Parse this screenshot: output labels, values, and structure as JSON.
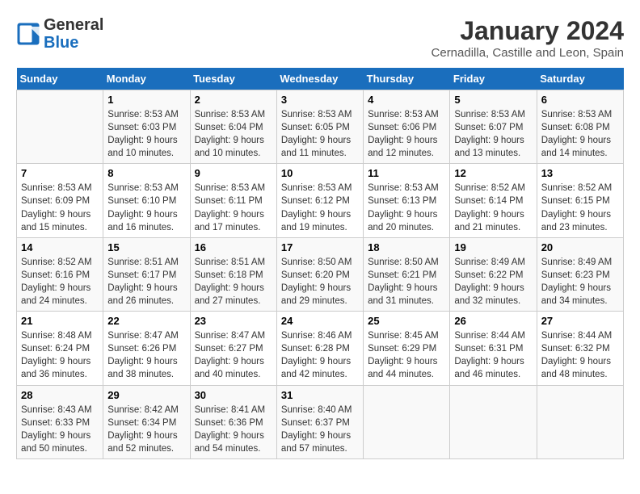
{
  "logo": {
    "line1": "General",
    "line2": "Blue"
  },
  "title": "January 2024",
  "subtitle": "Cernadilla, Castille and Leon, Spain",
  "days_of_week": [
    "Sunday",
    "Monday",
    "Tuesday",
    "Wednesday",
    "Thursday",
    "Friday",
    "Saturday"
  ],
  "weeks": [
    [
      {
        "day": "",
        "text": ""
      },
      {
        "day": "1",
        "text": "Sunrise: 8:53 AM\nSunset: 6:03 PM\nDaylight: 9 hours\nand 10 minutes."
      },
      {
        "day": "2",
        "text": "Sunrise: 8:53 AM\nSunset: 6:04 PM\nDaylight: 9 hours\nand 10 minutes."
      },
      {
        "day": "3",
        "text": "Sunrise: 8:53 AM\nSunset: 6:05 PM\nDaylight: 9 hours\nand 11 minutes."
      },
      {
        "day": "4",
        "text": "Sunrise: 8:53 AM\nSunset: 6:06 PM\nDaylight: 9 hours\nand 12 minutes."
      },
      {
        "day": "5",
        "text": "Sunrise: 8:53 AM\nSunset: 6:07 PM\nDaylight: 9 hours\nand 13 minutes."
      },
      {
        "day": "6",
        "text": "Sunrise: 8:53 AM\nSunset: 6:08 PM\nDaylight: 9 hours\nand 14 minutes."
      }
    ],
    [
      {
        "day": "7",
        "text": "Sunrise: 8:53 AM\nSunset: 6:09 PM\nDaylight: 9 hours\nand 15 minutes."
      },
      {
        "day": "8",
        "text": "Sunrise: 8:53 AM\nSunset: 6:10 PM\nDaylight: 9 hours\nand 16 minutes."
      },
      {
        "day": "9",
        "text": "Sunrise: 8:53 AM\nSunset: 6:11 PM\nDaylight: 9 hours\nand 17 minutes."
      },
      {
        "day": "10",
        "text": "Sunrise: 8:53 AM\nSunset: 6:12 PM\nDaylight: 9 hours\nand 19 minutes."
      },
      {
        "day": "11",
        "text": "Sunrise: 8:53 AM\nSunset: 6:13 PM\nDaylight: 9 hours\nand 20 minutes."
      },
      {
        "day": "12",
        "text": "Sunrise: 8:52 AM\nSunset: 6:14 PM\nDaylight: 9 hours\nand 21 minutes."
      },
      {
        "day": "13",
        "text": "Sunrise: 8:52 AM\nSunset: 6:15 PM\nDaylight: 9 hours\nand 23 minutes."
      }
    ],
    [
      {
        "day": "14",
        "text": "Sunrise: 8:52 AM\nSunset: 6:16 PM\nDaylight: 9 hours\nand 24 minutes."
      },
      {
        "day": "15",
        "text": "Sunrise: 8:51 AM\nSunset: 6:17 PM\nDaylight: 9 hours\nand 26 minutes."
      },
      {
        "day": "16",
        "text": "Sunrise: 8:51 AM\nSunset: 6:18 PM\nDaylight: 9 hours\nand 27 minutes."
      },
      {
        "day": "17",
        "text": "Sunrise: 8:50 AM\nSunset: 6:20 PM\nDaylight: 9 hours\nand 29 minutes."
      },
      {
        "day": "18",
        "text": "Sunrise: 8:50 AM\nSunset: 6:21 PM\nDaylight: 9 hours\nand 31 minutes."
      },
      {
        "day": "19",
        "text": "Sunrise: 8:49 AM\nSunset: 6:22 PM\nDaylight: 9 hours\nand 32 minutes."
      },
      {
        "day": "20",
        "text": "Sunrise: 8:49 AM\nSunset: 6:23 PM\nDaylight: 9 hours\nand 34 minutes."
      }
    ],
    [
      {
        "day": "21",
        "text": "Sunrise: 8:48 AM\nSunset: 6:24 PM\nDaylight: 9 hours\nand 36 minutes."
      },
      {
        "day": "22",
        "text": "Sunrise: 8:47 AM\nSunset: 6:26 PM\nDaylight: 9 hours\nand 38 minutes."
      },
      {
        "day": "23",
        "text": "Sunrise: 8:47 AM\nSunset: 6:27 PM\nDaylight: 9 hours\nand 40 minutes."
      },
      {
        "day": "24",
        "text": "Sunrise: 8:46 AM\nSunset: 6:28 PM\nDaylight: 9 hours\nand 42 minutes."
      },
      {
        "day": "25",
        "text": "Sunrise: 8:45 AM\nSunset: 6:29 PM\nDaylight: 9 hours\nand 44 minutes."
      },
      {
        "day": "26",
        "text": "Sunrise: 8:44 AM\nSunset: 6:31 PM\nDaylight: 9 hours\nand 46 minutes."
      },
      {
        "day": "27",
        "text": "Sunrise: 8:44 AM\nSunset: 6:32 PM\nDaylight: 9 hours\nand 48 minutes."
      }
    ],
    [
      {
        "day": "28",
        "text": "Sunrise: 8:43 AM\nSunset: 6:33 PM\nDaylight: 9 hours\nand 50 minutes."
      },
      {
        "day": "29",
        "text": "Sunrise: 8:42 AM\nSunset: 6:34 PM\nDaylight: 9 hours\nand 52 minutes."
      },
      {
        "day": "30",
        "text": "Sunrise: 8:41 AM\nSunset: 6:36 PM\nDaylight: 9 hours\nand 54 minutes."
      },
      {
        "day": "31",
        "text": "Sunrise: 8:40 AM\nSunset: 6:37 PM\nDaylight: 9 hours\nand 57 minutes."
      },
      {
        "day": "",
        "text": ""
      },
      {
        "day": "",
        "text": ""
      },
      {
        "day": "",
        "text": ""
      }
    ]
  ]
}
